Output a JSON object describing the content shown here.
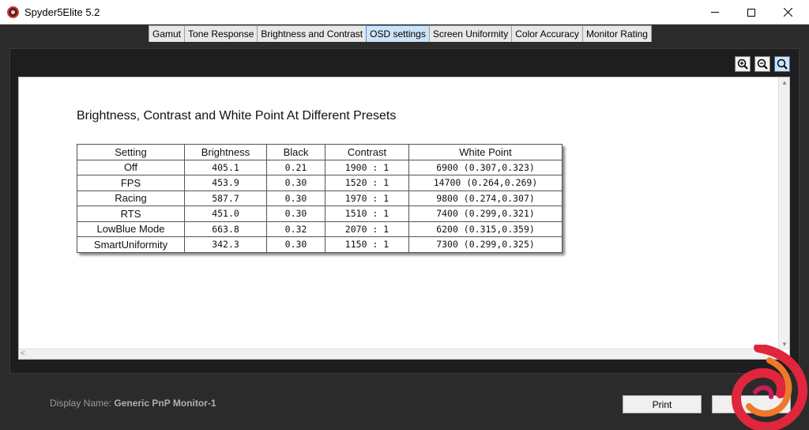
{
  "window": {
    "title": "Spyder5Elite 5.2"
  },
  "tabs": [
    {
      "label": "Gamut",
      "active": false
    },
    {
      "label": "Tone Response",
      "active": false
    },
    {
      "label": "Brightness and Contrast",
      "active": false
    },
    {
      "label": "OSD settings",
      "active": true
    },
    {
      "label": "Screen Uniformity",
      "active": false
    },
    {
      "label": "Color Accuracy",
      "active": false
    },
    {
      "label": "Monitor Rating",
      "active": false
    }
  ],
  "report": {
    "title": "Brightness, Contrast and White Point At Different Presets",
    "columns": [
      "Setting",
      "Brightness",
      "Black",
      "Contrast",
      "White Point"
    ],
    "rows": [
      [
        "Off",
        "405.1",
        "0.21",
        "1900 : 1",
        "6900 (0.307,0.323)"
      ],
      [
        "FPS",
        "453.9",
        "0.30",
        "1520 : 1",
        "14700 (0.264,0.269)"
      ],
      [
        "Racing",
        "587.7",
        "0.30",
        "1970 : 1",
        "9800 (0.274,0.307)"
      ],
      [
        "RTS",
        "451.0",
        "0.30",
        "1510 : 1",
        "7400 (0.299,0.321)"
      ],
      [
        "LowBlue Mode",
        "663.8",
        "0.32",
        "2070 : 1",
        "6200 (0.315,0.359)"
      ],
      [
        "SmartUniformity",
        "342.3",
        "0.30",
        "1150 : 1",
        "7300 (0.299,0.325)"
      ]
    ]
  },
  "footer": {
    "display_label": "Display Name:",
    "display_value": "Generic PnP Monitor-1",
    "print_label": "Print"
  },
  "icons": {
    "app": "spyder-app-icon",
    "zoom_in": "zoom-in-icon",
    "zoom_out": "zoom-out-icon",
    "zoom_fit": "zoom-fit-icon",
    "logo": "site-logo"
  },
  "colors": {
    "active_tab": "#cde3f7",
    "panel": "#1e1e1e",
    "logo_red": "#e0263c",
    "logo_orange": "#f0782a"
  }
}
